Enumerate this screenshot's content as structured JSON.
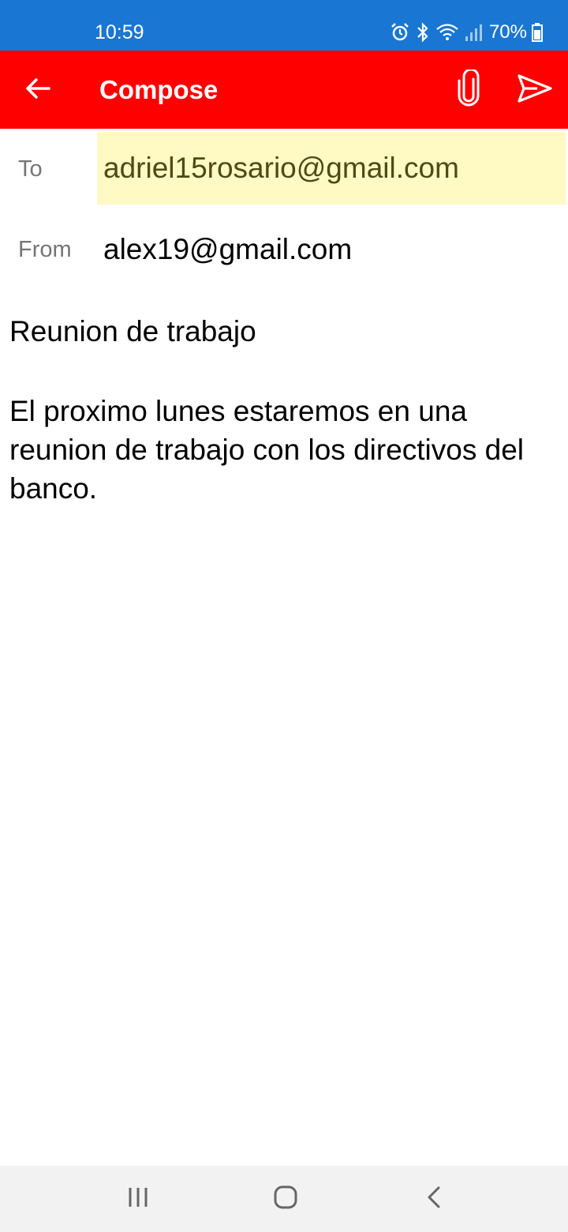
{
  "status_bar": {
    "time": "10:59",
    "battery": "70%",
    "icons": [
      "alarm-icon",
      "bluetooth-icon",
      "wifi-icon",
      "signal-icon",
      "battery-icon"
    ]
  },
  "app_bar": {
    "title": "Compose",
    "back_icon": "arrow-back-icon",
    "attach_icon": "paperclip-icon",
    "send_icon": "send-icon",
    "background_color": "#ff0000"
  },
  "fields": {
    "to_label": "To",
    "to_value": "adriel15rosario@gmail.com",
    "from_label": "From",
    "from_value": "alex19@gmail.com"
  },
  "subject": "Reunion de trabajo",
  "body": "El proximo lunes estaremos en una reunion de trabajo con los directivos del banco.",
  "nav_bar": {
    "items": [
      "recents-icon",
      "home-icon",
      "back-icon"
    ]
  },
  "colors": {
    "status_bar": "#1976d2",
    "app_bar": "#ff0000",
    "to_highlight": "#fff9c4"
  }
}
